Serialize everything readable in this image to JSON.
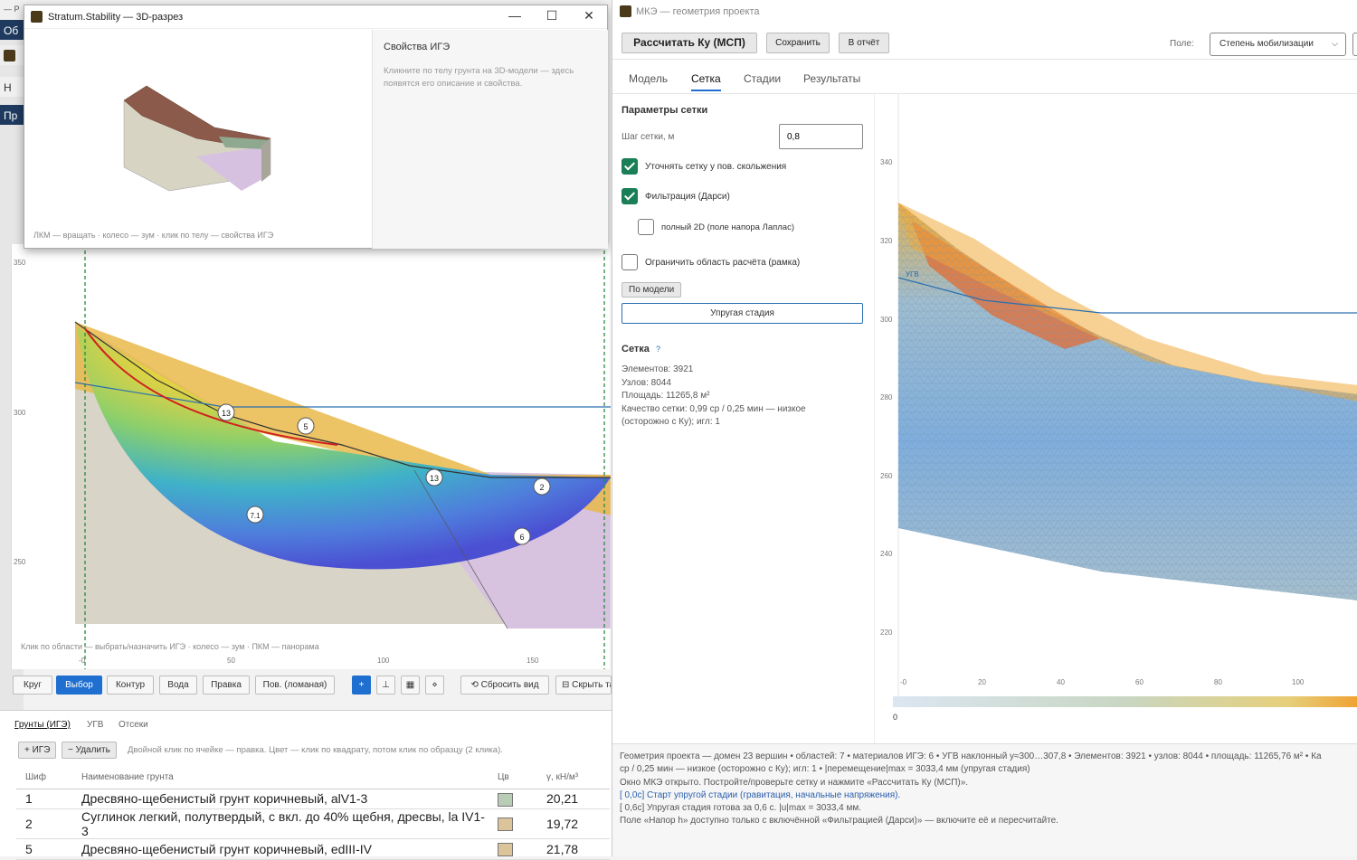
{
  "left_app": {
    "back_strip": [
      "— Р",
      "Об",
      "Н",
      "Пр"
    ],
    "axis_y_ticks": [
      "350",
      "300",
      "250"
    ],
    "axis_x_ticks": [
      "-0",
      "50",
      "100",
      "150"
    ],
    "hint": "Клик по области — выбрать/назначить ИГЭ · колесо — зум · ПКМ — панорама",
    "labels": [
      "13",
      "5",
      "13",
      "2",
      "7.1",
      "6"
    ],
    "toolbar": {
      "tools": [
        "Круг",
        "Выбор",
        "Контур",
        "Вода",
        "Правка",
        "Пов. (ломаная)"
      ],
      "selected": "Выбор",
      "icons": [
        "+",
        "⊥",
        "▦",
        "⋄"
      ],
      "reset_view": "⟲ Сбросить вид",
      "hide": "⊟ Скрыть та"
    },
    "bottom": {
      "tabs": [
        "Грунты (ИГЭ)",
        "УГВ",
        "Отсеки"
      ],
      "add_button": "+ ИГЭ",
      "delete_button": "− Удалить",
      "hint": "Двойной клик по ячейке — правка. Цвет — клик по квадрату, потом клик по образцу (2 клика).",
      "columns": [
        "Шиф",
        "Наименование грунта",
        "Цв",
        "γ, кН/м³"
      ],
      "rows": [
        {
          "code": "1",
          "name": "Дресвяно-щебенистый грунт коричневый, alV1-3",
          "color": "#b9cdb6",
          "gamma": "20,21"
        },
        {
          "code": "2",
          "name": "Суглинок легкий, полутвердый, с вкл. до 40% щебня,  дресвы, la IV1-3",
          "color": "#dcc49a",
          "gamma": "19,72"
        },
        {
          "code": "5",
          "name": "Дресвяно-щебенистый грунт коричневый, edIII-IV",
          "color": "#dcc49a",
          "gamma": "21,78"
        }
      ]
    }
  },
  "window_3d": {
    "title": "Stratum.Stability — 3D-разрез",
    "controls": [
      "—",
      "☐",
      "✕"
    ],
    "hint": "ЛКМ — вращать · колесо — зум · клик по телу — свойства ИГЭ",
    "side_title": "Свойства ИГЭ",
    "side_text": "Кликните по телу грунта на 3D-модели — здесь появятся его описание и свойства."
  },
  "right_app": {
    "title": "МКЭ — геометрия проекта",
    "toolbar": {
      "compute": "Рассчитать Ку (МСП)",
      "save": "Сохранить",
      "report": "В отчёт",
      "field_label": "Поле:",
      "field_value": "Степень мобилизации"
    },
    "tabs": [
      "Модель",
      "Сетка",
      "Стадии",
      "Результаты"
    ],
    "active_tab": "Сетка",
    "params": {
      "section_title": "Параметры сетки",
      "step_label": "Шаг сетки, м",
      "step_value": "0,8",
      "refine_label": "Уточнять сетку у пов. скольжения",
      "refine_checked": true,
      "filtration_label": "Фильтрация (Дарси)",
      "filtration_checked": true,
      "laplace_label": "полный 2D (поле напора Лаплас)",
      "laplace_checked": false,
      "limit_label": "Ограничить область расчёта (рамка)",
      "limit_checked": false,
      "by_model": "По модели",
      "elastic_stage": "Упругая стадия",
      "mesh_title": "Сетка",
      "help": "?",
      "stats": [
        "Элементов: 3921",
        "Узлов: 8044",
        "Площадь: 11265,8 м²",
        "Качество сетки: 0,99 ср / 0,25 мин — низкое",
        "(осторожно с Ку); игл: 1"
      ]
    },
    "mesh_plot": {
      "y_ticks": [
        "340",
        "320",
        "300",
        "280",
        "260",
        "240",
        "220"
      ],
      "x_ticks": [
        "-0",
        "20",
        "40",
        "60",
        "80",
        "100"
      ],
      "colorbar_min": "0",
      "ugv_label": "УГВ"
    },
    "log": [
      {
        "text": "Геометрия проекта — домен 23 вершин • областей: 7 • материалов ИГЭ: 6 • УГВ наклонный y≈300…307,8 • Элементов: 3921 • узлов: 8044 • площадь: 11265,76 м² • Ка",
        "blue": false
      },
      {
        "text": "ср / 0,25 мин — низкое (осторожно с Ку); игл: 1 • |перемещение|max = 3033,4 мм (упругая стадия)",
        "blue": false
      },
      {
        "text": "Окно МКЭ открыто. Постройте/проверьте сетку и нажмите «Рассчитать Ку (МСП)».",
        "blue": false
      },
      {
        "text": "[  0,0с] Старт упругой стадии (гравитация, начальные напряжения).",
        "blue": true
      },
      {
        "text": "[  0,6с] Упругая стадия готова за 0,6 с. |u|max = 3033,4 мм.",
        "blue": false
      },
      {
        "text": "Поле «Напор h» доступно только с включённой «Фильтрацией (Дарси)» — включите её и пересчитайте.",
        "blue": false
      }
    ]
  }
}
